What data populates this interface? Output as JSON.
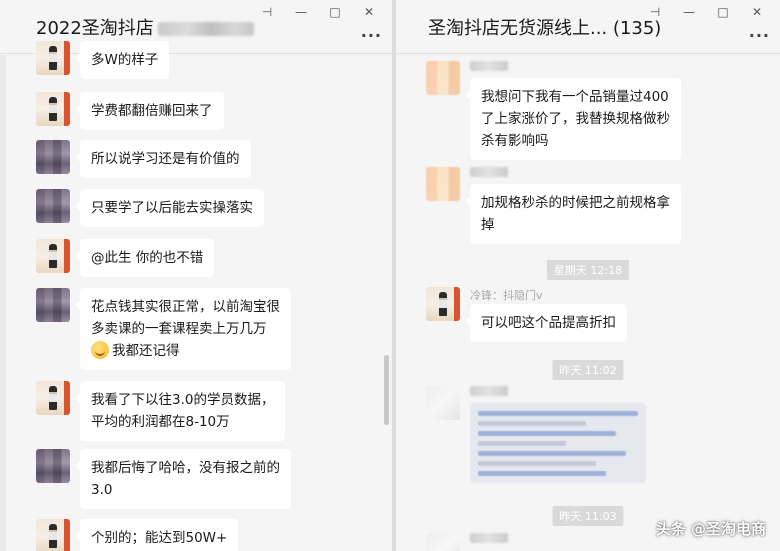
{
  "left": {
    "title": "2022圣淘抖店",
    "controls": {
      "pin": "⊣",
      "minimize": "—",
      "maximize": "□",
      "close": "✕"
    },
    "more": "···",
    "messages": [
      {
        "avatar": "photo",
        "text": "多W的样子"
      },
      {
        "avatar": "photo",
        "text": "学费都翻倍赚回来了"
      },
      {
        "avatar": "pix",
        "text": "所以说学习还是有价值的"
      },
      {
        "avatar": "pix",
        "text": "只要学了以后能去实操落实"
      },
      {
        "avatar": "photo",
        "text": "@此生 你的也不错"
      },
      {
        "avatar": "pix",
        "text": "花点钱其实很正常，以前淘宝很\n多卖课的一套课程卖上万几万",
        "emoji_text": "我都还记得"
      },
      {
        "avatar": "photo",
        "text": "我看了下以往3.0的学员数据，\n平均的利润都在8-10万"
      },
      {
        "avatar": "pix",
        "text": "我都后悔了哈哈，没有报之前的\n3.0"
      },
      {
        "avatar": "photo",
        "text": "个别的；能达到50W+"
      }
    ]
  },
  "right": {
    "title": "圣淘抖店无货源线上... (135)",
    "controls": {
      "pin": "⊣",
      "minimize": "—",
      "maximize": "□",
      "close": "✕"
    },
    "more": "···",
    "messages": [
      {
        "avatar": "peach",
        "sender": "",
        "text": "我想问下我有一个品销量过400\n了上家涨价了，我替换规格做秒\n杀有影响吗"
      },
      {
        "avatar": "peach",
        "sender": "",
        "text": "加规格秒杀的时候把之前规格拿\n掉"
      },
      {
        "avatar": "photo",
        "sender": "冷锋：抖隐门v",
        "text": "可以吧这个品提高折扣"
      },
      {
        "avatar": "pale",
        "sender": "",
        "text": ""
      }
    ],
    "times": [
      "星期天 12:18",
      "昨天 11:02",
      "昨天 11:03"
    ]
  },
  "watermark": "头条 @圣淘电商"
}
